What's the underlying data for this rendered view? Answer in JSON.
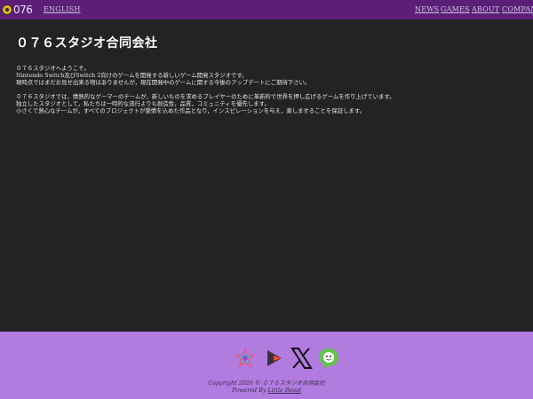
{
  "header": {
    "logo_text": "076",
    "lang_link": "ENGLISH",
    "nav": [
      "NEWS",
      "GAMES",
      "ABOUT",
      "COMPANY"
    ]
  },
  "main": {
    "title": "０７６スタジオ合同会社",
    "paragraph1": [
      "０７６スタジオへようこそ。",
      "Nintendo Switch及びSwitch 2向けのゲームを開発する新しいゲーム開発スタジオです。",
      "現時点ではまだお見せ出来る物はありませんが，現在開発中のゲームに関する今後のアップデートにご期待下さい。"
    ],
    "paragraph2": [
      "０７６スタジオでは，情熱的なゲーマーのチームが，新しいものを求めるプレイヤーのために革新的で世界を押し広げるゲームを作り上げています。",
      "独立したスタジオとして，私たちは一時的な流行よりも創造性，品質，コミュニティを優先します。",
      "小さくて熱心なチームが，すべてのプロジェクトが愛情を込めた作品となり，インスピレーションを与え，楽しませることを保証します。"
    ]
  },
  "footer": {
    "social": [
      "itch-icon",
      "play-icon",
      "x-icon",
      "chat-icon"
    ],
    "copyright": "Copyright 2026 © ０７６スタジオ合同会社",
    "powered_prefix": "Powered By",
    "powered_link": "Little Beast"
  },
  "colors": {
    "topbar": "#5b1f78",
    "background": "#232323",
    "footer": "#b17be0"
  }
}
